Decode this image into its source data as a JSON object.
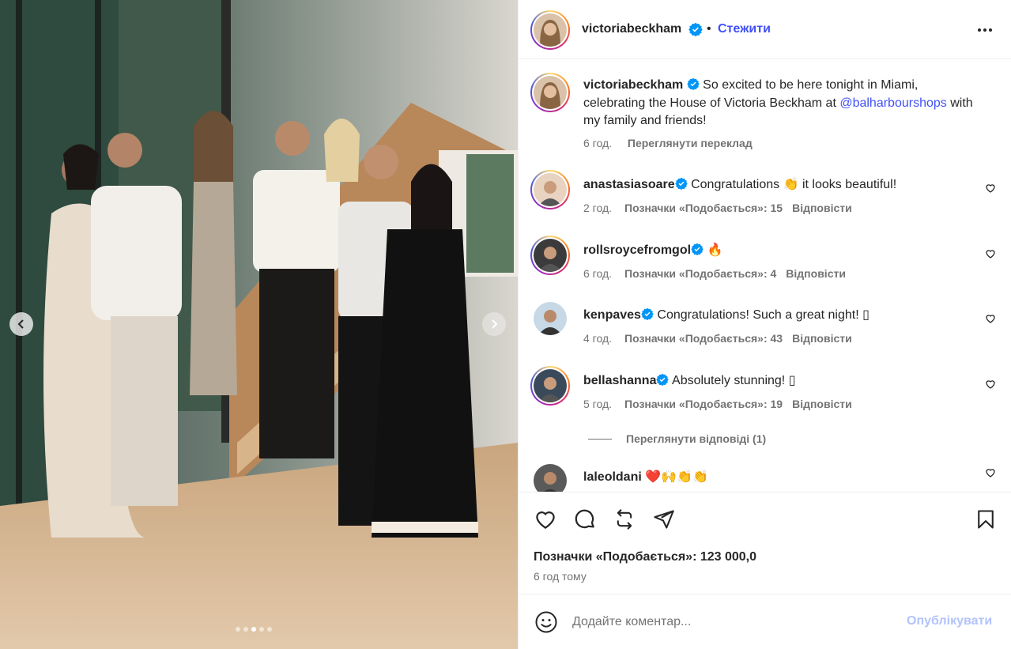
{
  "post": {
    "author": "victoriabeckham",
    "follow_label": "Стежити",
    "separator": "•",
    "carousel": {
      "total_slides": 5,
      "active_slide": 3
    }
  },
  "caption": {
    "username": "victoriabeckham",
    "text_before": " So excited to be here tonight in Miami, celebrating the House of Victoria Beckham at ",
    "mention": "@balharbourshops",
    "text_after": " with my family and friends!",
    "time": "6 год.",
    "translate_label": "Переглянути переклад"
  },
  "comments": [
    {
      "username": "anastasiasoare",
      "verified": true,
      "text_before": " Congratulations ",
      "emoji": "👏",
      "text_after": " it looks beautiful!",
      "time": "2 год.",
      "likes": "Позначки «Подобається»: 15",
      "reply": "Відповісти"
    },
    {
      "username": "rollsroycefromgol",
      "verified": true,
      "text_before": " ",
      "emoji": "🔥",
      "text_after": "",
      "time": "6 год.",
      "likes": "Позначки «Подобається»: 4",
      "reply": "Відповісти"
    },
    {
      "username": "kenpaves",
      "verified": true,
      "text_before": " Congratulations! Such a great night! ",
      "emoji": "▯",
      "text_after": "",
      "time": "4 год.",
      "likes": "Позначки «Подобається»: 43",
      "reply": "Відповісти"
    },
    {
      "username": "bellashanna",
      "verified": true,
      "text_before": " Absolutely stunning! ",
      "emoji": "▯",
      "text_after": "",
      "time": "5 год.",
      "likes": "Позначки «Подобається»: 19",
      "reply": "Відповісти"
    },
    {
      "username": "laleoldani",
      "verified": false,
      "text_before": " ",
      "emoji": "❤️🙌👏👏",
      "text_after": "",
      "time": "",
      "likes": "",
      "reply": ""
    }
  ],
  "view_replies_label": "Переглянути відповіді (1)",
  "actions": {
    "like_icon": "heart-icon",
    "comment_icon": "comment-icon",
    "repost_icon": "repost-icon",
    "share_icon": "share-icon",
    "save_icon": "bookmark-icon"
  },
  "likes_label": "Позначки «Подобається»: 123 000,0",
  "posted_ago": "6 год тому",
  "composer": {
    "placeholder": "Додайте коментар...",
    "publish_label": "Опублікувати",
    "emoji_icon": "smiley-icon"
  },
  "colors": {
    "link": "#4150f7",
    "verified": "#0095f6",
    "publish_disabled": "#b2c3fb",
    "muted": "#737373"
  }
}
